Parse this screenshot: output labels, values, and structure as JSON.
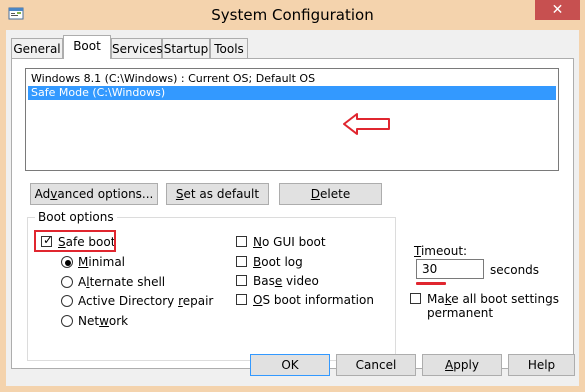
{
  "window": {
    "title": "System Configuration",
    "close_glyph": "✕"
  },
  "tabs": [
    {
      "label": "General"
    },
    {
      "label": "Boot"
    },
    {
      "label": "Services"
    },
    {
      "label": "Startup"
    },
    {
      "label": "Tools"
    }
  ],
  "os_list": [
    "Windows 8.1 (C:\\Windows) : Current OS; Default OS",
    "Safe Mode (C:\\Windows)"
  ],
  "list_buttons": {
    "advanced_hot": "v",
    "advanced_rest": "anced options...",
    "advanced_pre": "Ad",
    "set_default_hot": "S",
    "set_default_rest": "et as default",
    "delete_hot": "D",
    "delete_rest": "elete"
  },
  "boot_options": {
    "group_label": "Boot options",
    "safe_boot_hot": "S",
    "safe_boot_pre": "",
    "safe_boot_rest": "afe boot",
    "minimal_hot": "M",
    "minimal_rest": "inimal",
    "alternate_shell_hot": "l",
    "alternate_shell_pre": "A",
    "alternate_shell_rest": "ternate shell",
    "ad_repair_hot": "r",
    "ad_repair_pre": "Active Directory ",
    "ad_repair_rest": "epair",
    "network_hot": "w",
    "network_pre": "Net",
    "network_rest": "ork",
    "no_gui_hot": "N",
    "no_gui_rest": "o GUI boot",
    "boot_log_hot": "B",
    "boot_log_rest": "oot log",
    "base_video_hot": "e",
    "base_video_pre": "Bas",
    "base_video_rest": " video",
    "os_info_hot": "O",
    "os_info_rest": "S boot information"
  },
  "timeout": {
    "label_hot": "T",
    "label_rest": "imeout:",
    "value": "30",
    "unit": "seconds"
  },
  "permanent": {
    "line1_pre": "Ma",
    "line1_hot": "k",
    "line1_rest": "e all boot settings",
    "line2": "permanent"
  },
  "footer": {
    "ok": "OK",
    "cancel": "Cancel",
    "apply_hot": "A",
    "apply_rest": "pply",
    "help": "Help"
  },
  "colors": {
    "accent": "#e0262f",
    "selection": "#3399ff",
    "frame": "#f4d3ad"
  }
}
